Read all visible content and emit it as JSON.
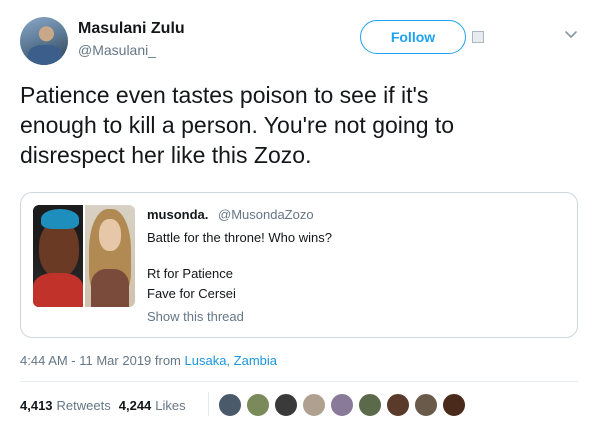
{
  "user": {
    "name": "Masulani Zulu",
    "handle": "@Masulani_",
    "follow_label": "Follow"
  },
  "tweet": {
    "text_lines": [
      "Patience even tastes poison to see if it's",
      "enough to kill a person. You're not going to",
      "disrespect her like this Zozo."
    ]
  },
  "quote": {
    "name": "musonda.",
    "handle": "@MusondaZozo",
    "line1": "Battle for the throne! Who wins?",
    "line2": "Rt for Patience",
    "line3": "Fave for Cersei",
    "show_thread": "Show this thread"
  },
  "meta": {
    "time_date": "4:44 AM - 11 Mar 2019 from",
    "location": "Lusaka, Zambia"
  },
  "stats": {
    "retweets_count": "4,413",
    "retweets_label": "Retweets",
    "likes_count": "4,244",
    "likes_label": "Likes"
  },
  "icons": {
    "more": "chevron-down-icon"
  },
  "colors": {
    "accent": "#1da1f2",
    "text": "#14171a",
    "muted": "#657786",
    "link": "#1b95e0",
    "border": "#ccd6dd"
  },
  "liker_colors": [
    "#4a5a6a",
    "#7a8a5a",
    "#3a3a3a",
    "#b0a090",
    "#8a7a9a",
    "#5a6a4a",
    "#5a3a2a",
    "#6a5a4a",
    "#4a2a1a"
  ]
}
